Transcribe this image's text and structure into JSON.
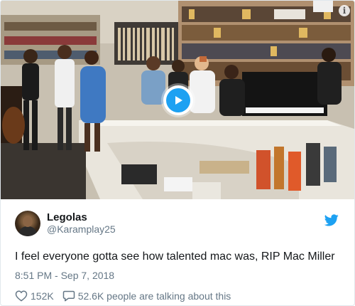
{
  "media": {
    "play_icon": "play-icon",
    "info_icon": "info-icon",
    "info_glyph": "i"
  },
  "tweet": {
    "display_name": "Legolas",
    "handle": "@Karamplay25",
    "text": "I feel everyone gotta see how talented mac was, RIP Mac Miller",
    "timestamp": "8:51 PM - Sep 7, 2018",
    "likes": "152K",
    "talking": "52.6K people are talking about this"
  },
  "colors": {
    "accent": "#1da1f2",
    "text_primary": "#14171a",
    "text_secondary": "#657786",
    "border": "#e1e8ed"
  },
  "icons": {
    "brand": "twitter-bird-icon",
    "like": "heart-icon",
    "reply": "speech-bubble-icon"
  }
}
